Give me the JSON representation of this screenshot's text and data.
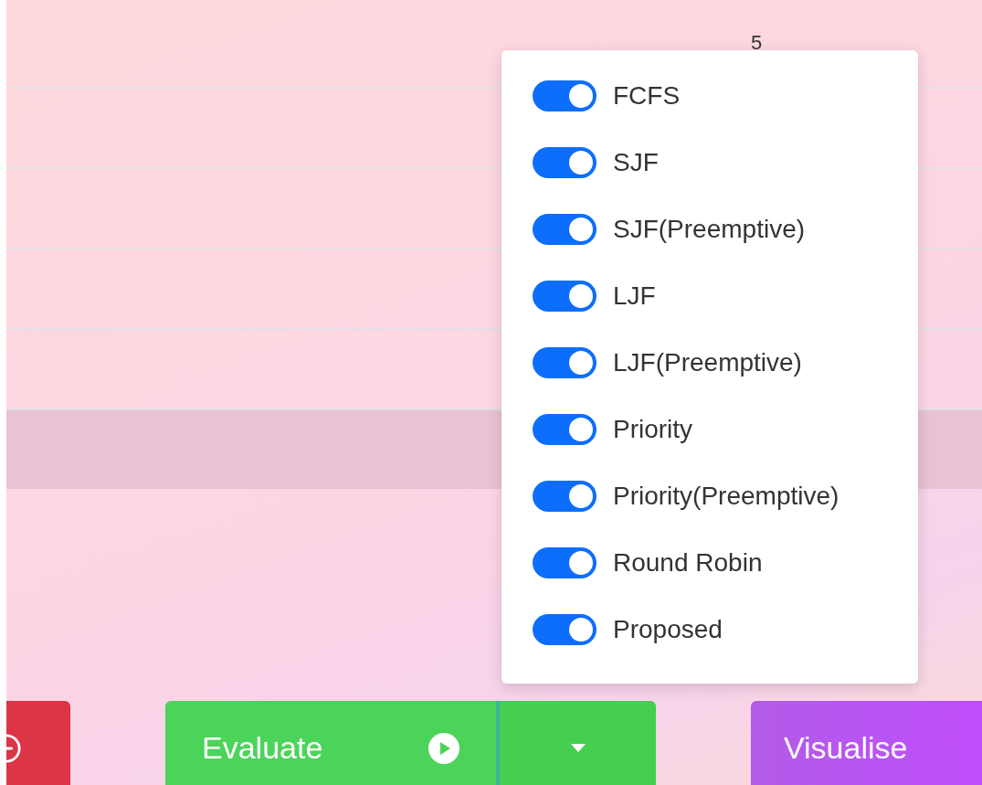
{
  "table": {
    "header_cell": "5"
  },
  "algorithm_menu": {
    "items": [
      {
        "label": "FCFS",
        "on": true
      },
      {
        "label": "SJF",
        "on": true
      },
      {
        "label": "SJF(Preemptive)",
        "on": true
      },
      {
        "label": "LJF",
        "on": true
      },
      {
        "label": "LJF(Preemptive)",
        "on": true
      },
      {
        "label": "Priority",
        "on": true
      },
      {
        "label": "Priority(Preemptive)",
        "on": true
      },
      {
        "label": "Round Robin",
        "on": true
      },
      {
        "label": "Proposed",
        "on": true
      }
    ]
  },
  "buttons": {
    "evaluate": "Evaluate",
    "visualise": "Visualise"
  }
}
